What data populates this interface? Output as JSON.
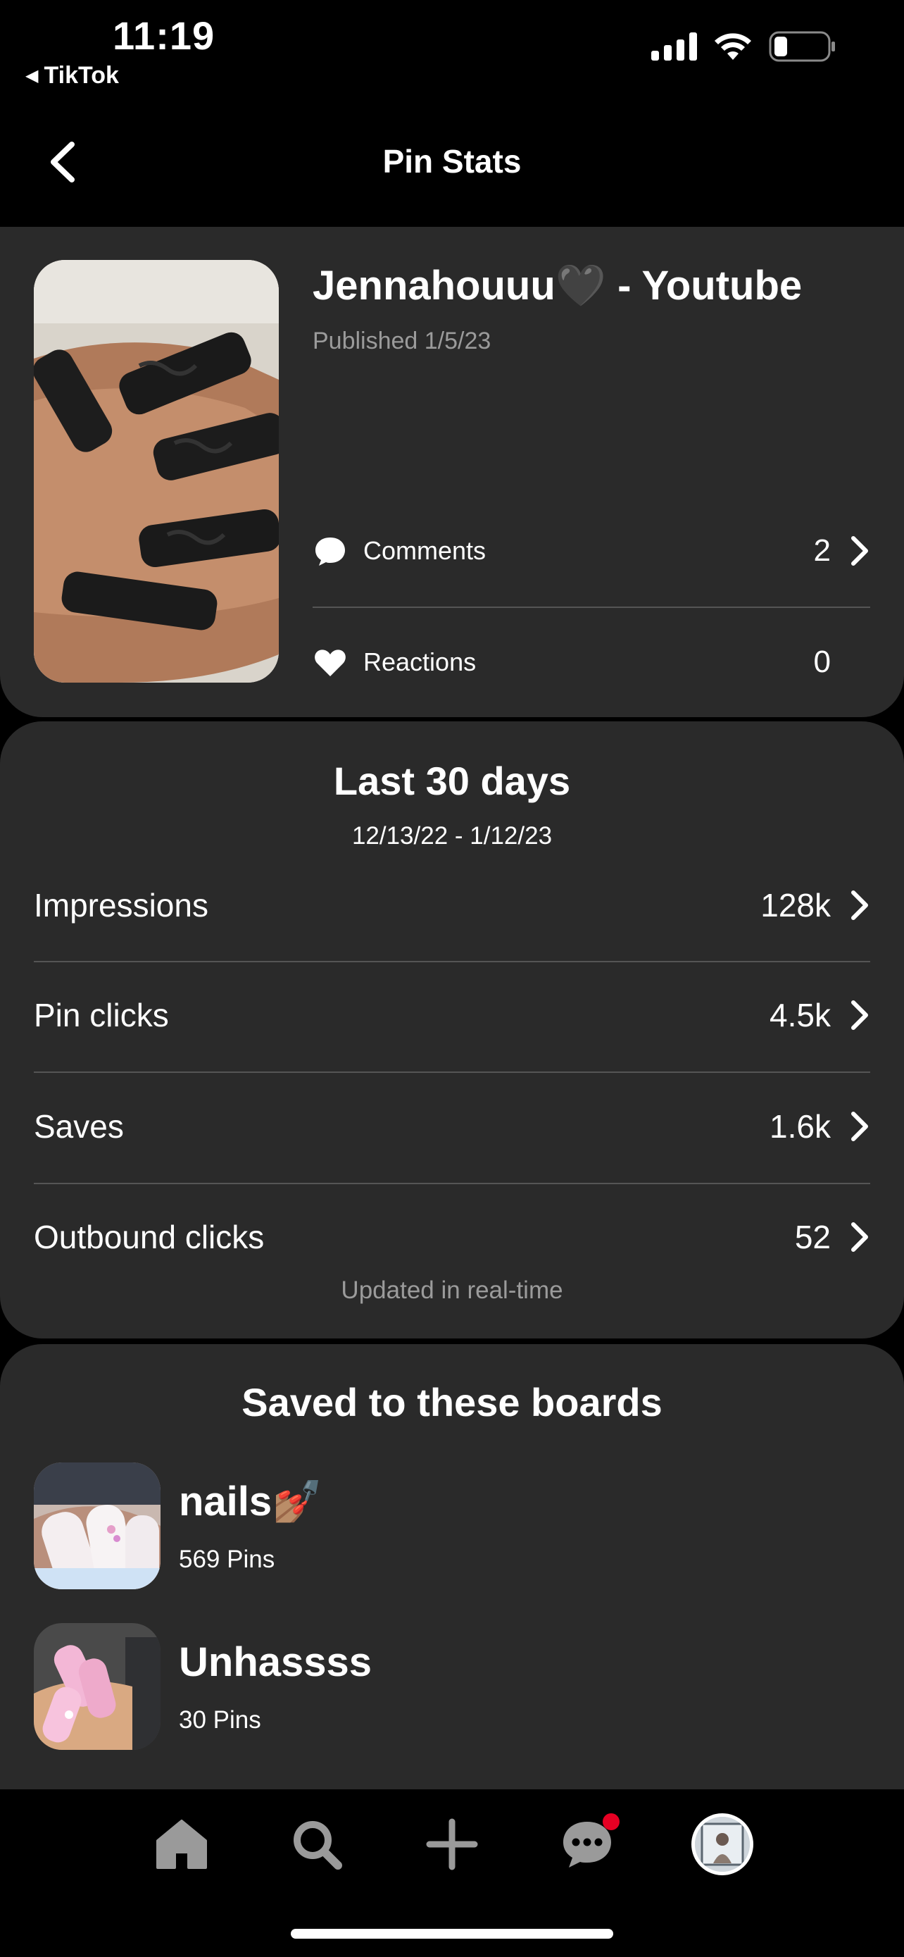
{
  "status_bar": {
    "time": "11:19",
    "back_app": "TikTok"
  },
  "nav": {
    "title": "Pin Stats"
  },
  "pin": {
    "title": "Jennahouuu🖤 - Youtube",
    "published": "Published 1/5/23",
    "comments_label": "Comments",
    "comments_count": "2",
    "reactions_label": "Reactions",
    "reactions_count": "0"
  },
  "stats": {
    "title": "Last 30 days",
    "range": "12/13/22 - 1/12/23",
    "rows": [
      {
        "label": "Impressions",
        "value": "128k"
      },
      {
        "label": "Pin clicks",
        "value": "4.5k"
      },
      {
        "label": "Saves",
        "value": "1.6k"
      },
      {
        "label": "Outbound clicks",
        "value": "52"
      }
    ],
    "updated": "Updated in real-time"
  },
  "boards": {
    "title": "Saved to these boards",
    "items": [
      {
        "name": "nails💅🏽",
        "count": "569 Pins"
      },
      {
        "name": "Unhassss",
        "count": "30 Pins"
      }
    ]
  },
  "bottom_nav": {
    "items": [
      "home",
      "search",
      "create",
      "messages",
      "profile"
    ],
    "notification_color": "#e60023"
  },
  "colors": {
    "background": "#000000",
    "card": "#2a2a2a",
    "muted_text": "#9b9b9b",
    "divider": "#555555"
  }
}
